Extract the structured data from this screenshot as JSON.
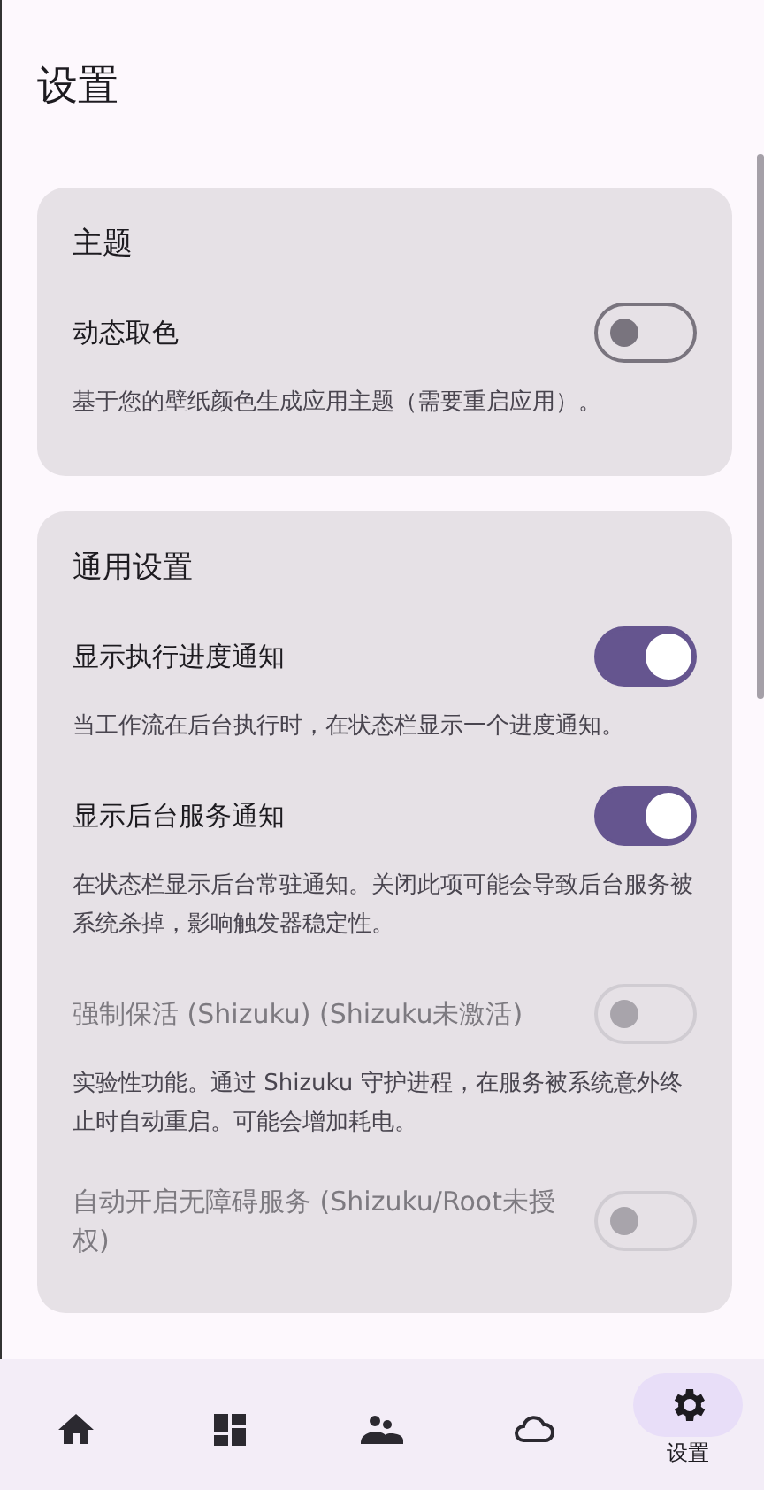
{
  "title": "设置",
  "sections": [
    {
      "title": "主题",
      "items": [
        {
          "kind": "toggle",
          "label": "动态取色",
          "on": false,
          "disabled": false,
          "description": "基于您的壁纸颜色生成应用主题（需要重启应用）。"
        }
      ]
    },
    {
      "title": "通用设置",
      "items": [
        {
          "kind": "toggle",
          "label": "显示执行进度通知",
          "on": true,
          "disabled": false,
          "description": "当工作流在后台执行时，在状态栏显示一个进度通知。"
        },
        {
          "kind": "toggle",
          "label": "显示后台服务通知",
          "on": true,
          "disabled": false,
          "description": "在状态栏显示后台常驻通知。关闭此项可能会导致后台服务被系统杀掉，影响触发器稳定性。"
        },
        {
          "kind": "toggle",
          "label": "强制保活 (Shizuku) (Shizuku未激活)",
          "on": false,
          "disabled": true,
          "description": "实验性功能。通过 Shizuku 守护进程，在服务被系统意外终止时自动重启。可能会增加耗电。"
        },
        {
          "kind": "toggle",
          "label": "自动开启无障碍服务 (Shizuku/Root未授权)",
          "on": false,
          "disabled": true
        }
      ]
    }
  ],
  "nav": [
    {
      "selected": false
    },
    {
      "selected": false
    },
    {
      "selected": false
    },
    {
      "selected": false
    },
    {
      "selected": true,
      "label": "设置"
    }
  ]
}
